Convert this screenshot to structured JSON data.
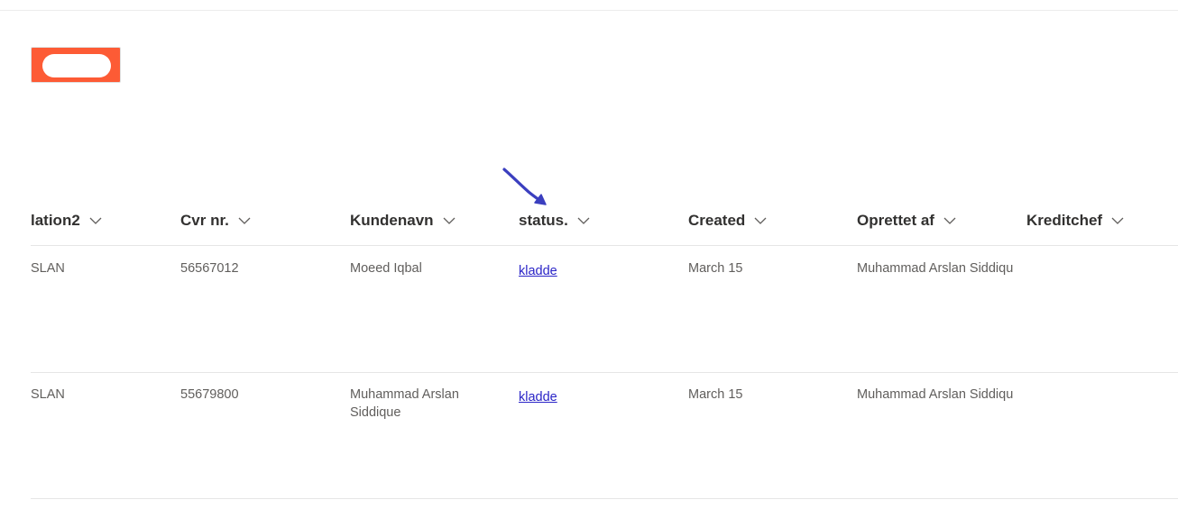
{
  "columns": [
    {
      "label": "lation2"
    },
    {
      "label": "Cvr nr."
    },
    {
      "label": "Kundenavn"
    },
    {
      "label": "status."
    },
    {
      "label": "Created"
    },
    {
      "label": "Oprettet af"
    },
    {
      "label": "Kreditchef"
    }
  ],
  "rows": [
    {
      "relation": "SLAN",
      "cvr": "56567012",
      "kundenavn": "Moeed Iqbal",
      "status": "kladde",
      "created": "March 15",
      "oprettet_af": "Muhammad Arslan Siddique",
      "kreditchef": ""
    },
    {
      "relation": "SLAN",
      "cvr": "55679800",
      "kundenavn": "Muhammad Arslan Siddique",
      "status": "kladde",
      "created": "March 15",
      "oprettet_af": "Muhammad Arslan Siddique",
      "kreditchef": ""
    }
  ],
  "colors": {
    "logo": "#fd5b35",
    "link": "#2a24c7",
    "annotation_arrow": "#3b3fbf",
    "header_text": "#323130",
    "cell_text": "#605e5c"
  }
}
